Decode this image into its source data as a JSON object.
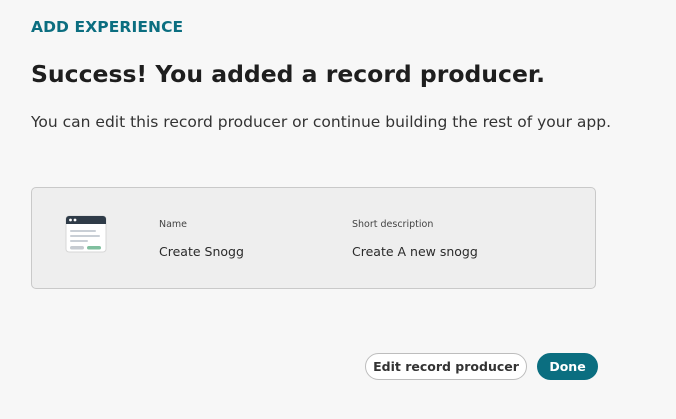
{
  "header": {
    "label": "ADD EXPERIENCE"
  },
  "main": {
    "title": "Success! You added a record producer.",
    "description": "You can edit this record producer or continue building the rest of your app."
  },
  "record": {
    "icon": "form-window-icon",
    "name_label": "Name",
    "name_value": "Create Snogg",
    "description_label": "Short description",
    "description_value": "Create A new snogg"
  },
  "actions": {
    "edit_label": "Edit record producer",
    "done_label": "Done"
  },
  "colors": {
    "accent": "#0b6e80",
    "background": "#f7f7f7",
    "card_background": "#eeeeee",
    "icon_green": "#7fbf9e"
  }
}
